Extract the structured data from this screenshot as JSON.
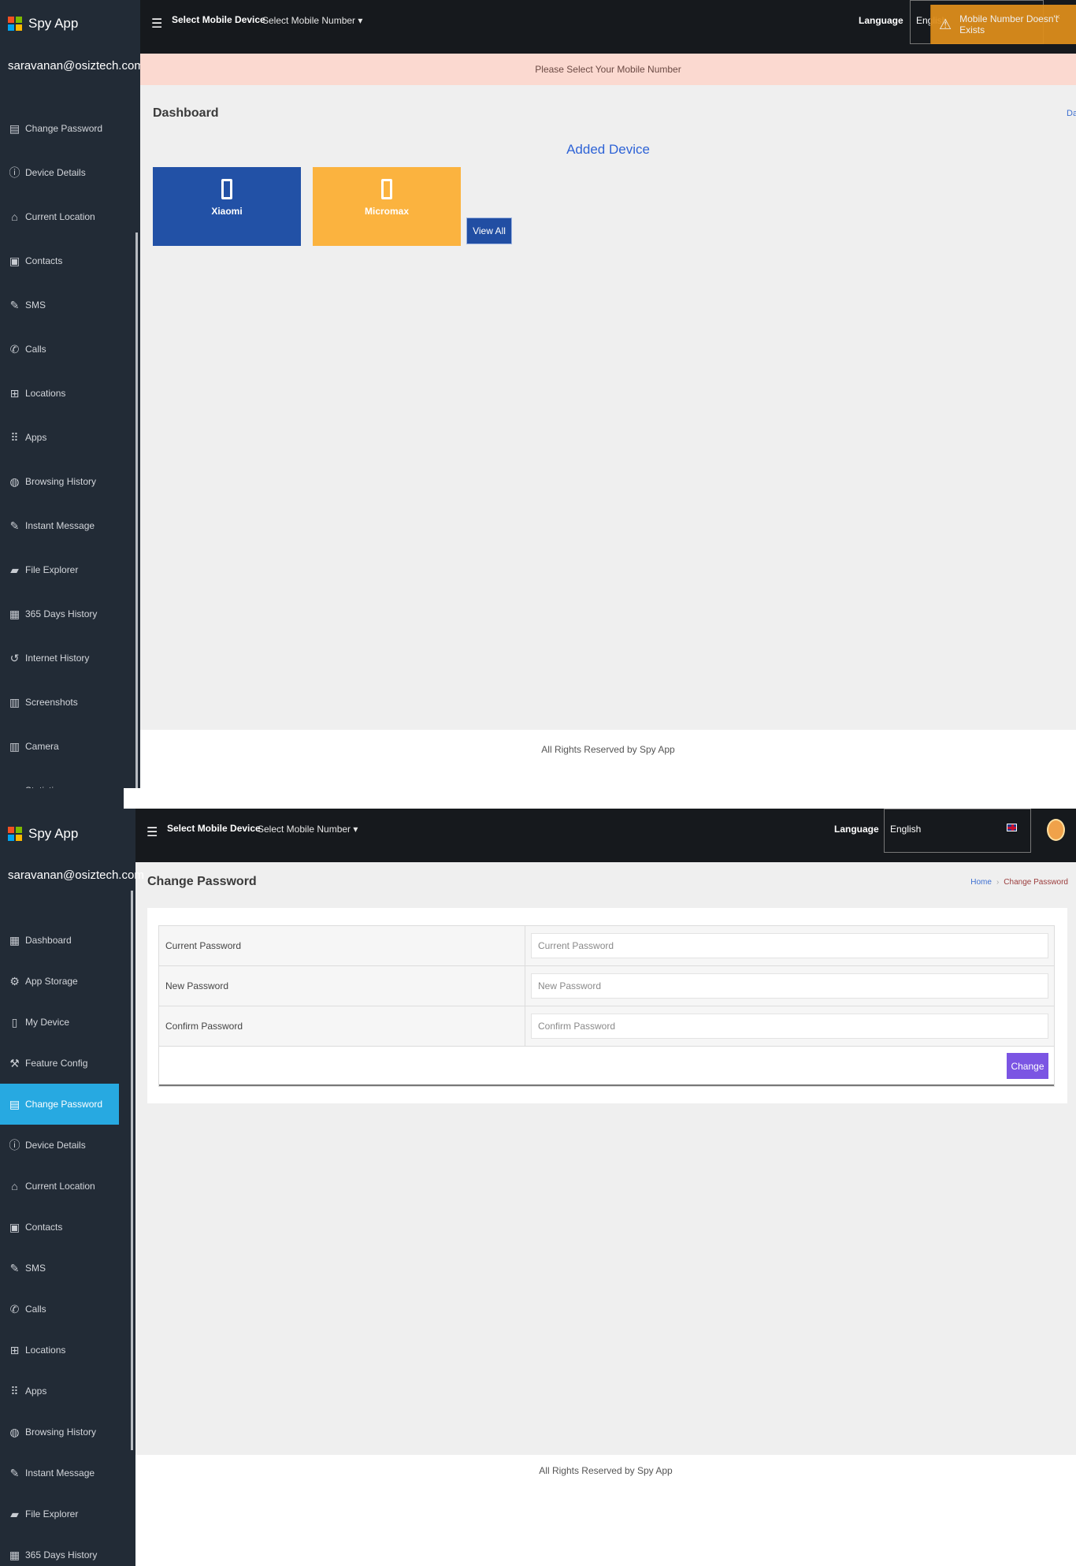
{
  "app": {
    "name": "Spy App",
    "user_email": "saravanan@osiztech.com"
  },
  "topbar": {
    "device_label": "Select Mobile Device",
    "number_label": "Select Mobile Number",
    "language_label": "Language",
    "language_value": "English",
    "language_value_truncated": "English"
  },
  "notification": {
    "message": "Mobile Number Doesn't Exists",
    "close": "×"
  },
  "alert": {
    "message": "Please Select Your Mobile Number"
  },
  "dashboard": {
    "title": "Dashboard",
    "breadcrumb_fragment": "Das",
    "section_title": "Added Device",
    "devices": [
      {
        "name": "Xiaomi",
        "color": "#2251a6"
      },
      {
        "name": "Micromax",
        "color": "#fbb33f"
      }
    ],
    "view_all": "View All"
  },
  "sidebar_top": {
    "items": [
      {
        "label": "Change Password",
        "icon": "document-icon"
      },
      {
        "label": "Device Details",
        "icon": "info-icon"
      },
      {
        "label": "Current Location",
        "icon": "home-icon"
      },
      {
        "label": "Contacts",
        "icon": "contacts-icon"
      },
      {
        "label": "SMS",
        "icon": "pencil-square-icon"
      },
      {
        "label": "Calls",
        "icon": "phone-icon"
      },
      {
        "label": "Locations",
        "icon": "map-icon"
      },
      {
        "label": "Apps",
        "icon": "grid-icon"
      },
      {
        "label": "Browsing History",
        "icon": "globe-icon"
      },
      {
        "label": "Instant Message",
        "icon": "pencil-square-icon"
      },
      {
        "label": "File Explorer",
        "icon": "folder-icon"
      },
      {
        "label": "365 Days History",
        "icon": "calendar-icon"
      },
      {
        "label": "Internet History",
        "icon": "history-icon"
      },
      {
        "label": "Screenshots",
        "icon": "gallery-icon"
      },
      {
        "label": "Camera",
        "icon": "gallery-icon"
      },
      {
        "label": "Statistics",
        "icon": "pie-chart-icon"
      }
    ]
  },
  "sidebar_bottom": {
    "items": [
      {
        "label": "Dashboard",
        "icon": "dashboard-icon"
      },
      {
        "label": "App Storage",
        "icon": "gear-icon"
      },
      {
        "label": "My Device",
        "icon": "mobile-icon"
      },
      {
        "label": "Feature Config",
        "icon": "wrench-icon"
      },
      {
        "label": "Change Password",
        "icon": "document-icon"
      },
      {
        "label": "Device Details",
        "icon": "info-icon"
      },
      {
        "label": "Current Location",
        "icon": "home-icon"
      },
      {
        "label": "Contacts",
        "icon": "contacts-icon"
      },
      {
        "label": "SMS",
        "icon": "pencil-square-icon"
      },
      {
        "label": "Calls",
        "icon": "phone-icon"
      },
      {
        "label": "Locations",
        "icon": "map-icon"
      },
      {
        "label": "Apps",
        "icon": "grid-icon"
      },
      {
        "label": "Browsing History",
        "icon": "globe-icon"
      },
      {
        "label": "Instant Message",
        "icon": "pencil-square-icon"
      },
      {
        "label": "File Explorer",
        "icon": "folder-icon"
      },
      {
        "label": "365 Days History",
        "icon": "calendar-icon"
      }
    ],
    "active_label": "Change Password"
  },
  "change_password": {
    "title": "Change Password",
    "breadcrumb": {
      "home": "Home",
      "sep": "›",
      "current": "Change Password"
    },
    "fields": [
      {
        "label": "Current Password",
        "placeholder": "Current Password",
        "value": ""
      },
      {
        "label": "New Password",
        "placeholder": "New Password",
        "value": ""
      },
      {
        "label": "Confirm Password",
        "placeholder": "Confirm Password",
        "value": ""
      }
    ],
    "submit": "Change"
  },
  "footer": {
    "text": "All Rights Reserved by Spy App"
  },
  "colors": {
    "sidebar": "#222b36",
    "topbar": "#16191d",
    "active": "#27a9e1",
    "toast": "#e08f1b",
    "change_button": "#7b55e3"
  }
}
